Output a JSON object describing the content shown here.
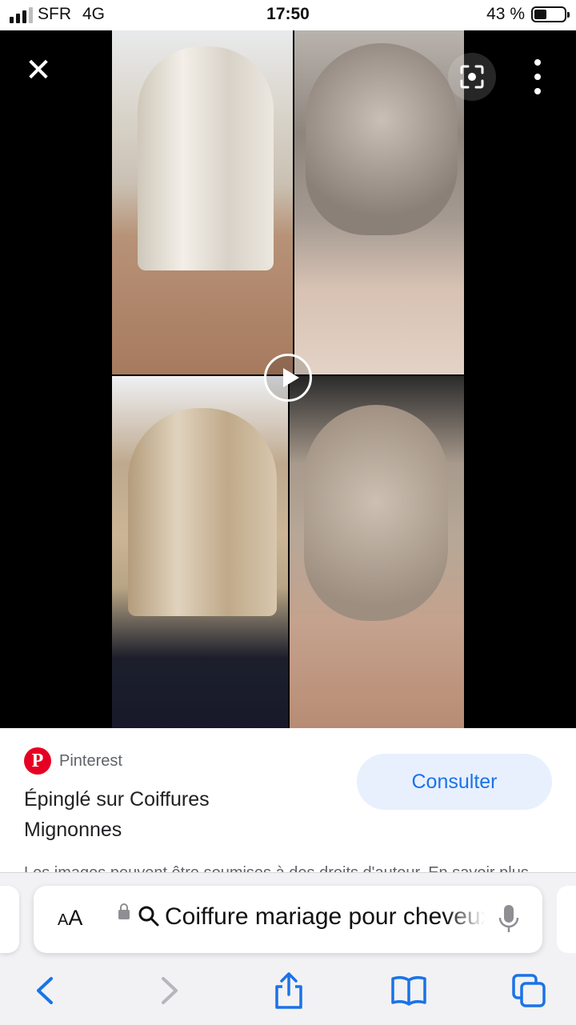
{
  "status_bar": {
    "carrier": "SFR",
    "network": "4G",
    "time": "17:50",
    "battery": "43 %",
    "battery_level": 0.43
  },
  "viewer": {
    "close_icon": "close-icon",
    "lens_icon": "google-lens-icon",
    "more_icon": "more-vertical-icon",
    "play_icon": "play-icon",
    "image_theme_colors": [
      "#000000",
      "#ffffff"
    ]
  },
  "result": {
    "source_name": "Pinterest",
    "source_icon": "pinterest-logo",
    "title": "Épinglé sur Coiffures Mignonnes",
    "visit_button": "Consulter",
    "copyright_notice": "Les images peuvent être soumises à des droits d'auteur. En savoir plus"
  },
  "browser": {
    "aa_label": "AA",
    "address_text": "Coiffure mariage pour cheveux mi-longs",
    "lock_icon": "lock-icon",
    "search_icon": "search-icon",
    "mic_icon": "microphone-icon",
    "accent_color": "#1a73e8"
  },
  "toolbar": {
    "back_icon": "chevron-left-icon",
    "forward_icon": "chevron-right-icon",
    "share_icon": "share-icon",
    "bookmarks_icon": "book-icon",
    "tabs_icon": "tabs-icon"
  }
}
